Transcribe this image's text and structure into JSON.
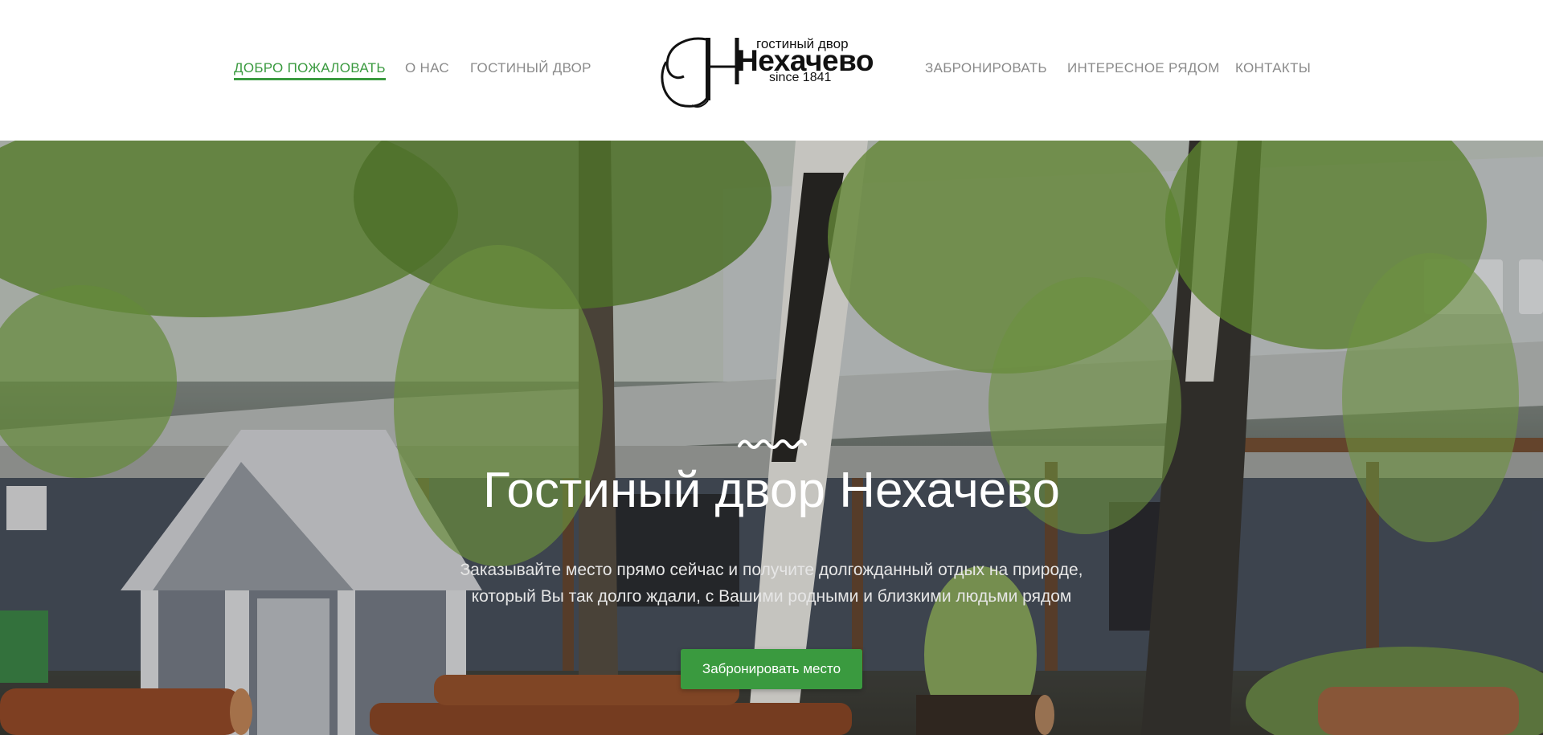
{
  "nav": {
    "left": [
      {
        "label": "ДОБРО ПОЖАЛОВАТЬ",
        "active": true
      },
      {
        "label": "О НАС",
        "active": false
      },
      {
        "label": "ГОСТИНЫЙ ДВОР",
        "active": false
      }
    ],
    "right": [
      {
        "label": "ЗАБРОНИРОВАТЬ",
        "active": false
      },
      {
        "label": "ИНТЕРЕСНОЕ РЯДОМ",
        "active": false
      },
      {
        "label": "КОНТАКТЫ",
        "active": false
      }
    ]
  },
  "logo": {
    "tagline": "гостиный двор",
    "name": "Нехачево",
    "since": "since 1841"
  },
  "hero": {
    "title": "Гостиный двор Нехачево",
    "subtitle_line1": "Заказывайте место прямо сейчас и получите долгожданный отдых на природе,",
    "subtitle_line2": "который Вы так долго ждали, с Вашими родными и близкими людьми рядом",
    "cta_label": "Забронировать место",
    "decor_icon": "wave-divider-icon"
  },
  "colors": {
    "accent": "#3a9a3f",
    "nav_text": "#8a8a8a",
    "header_bg": "#ffffff"
  }
}
